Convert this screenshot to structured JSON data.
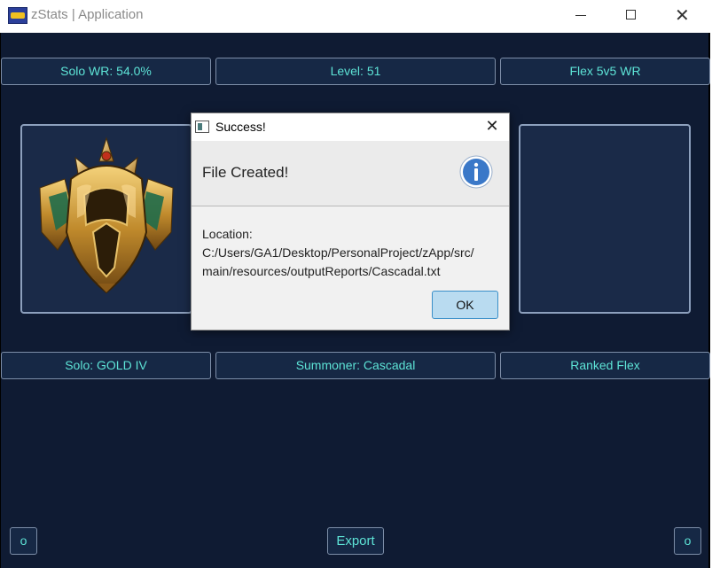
{
  "window": {
    "title": "zStats | Application",
    "icon": "zstats-logo-icon",
    "controls": [
      "minimize-icon",
      "maximize-icon",
      "close-icon"
    ]
  },
  "top_row": {
    "solo_wr": "Solo WR: 54.0%",
    "level": "Level: 51",
    "flex_wr": "Flex 5v5 WR"
  },
  "panels": {
    "left": {
      "emblem": "gold-rank-emblem-icon"
    },
    "right": {
      "emblem": ""
    }
  },
  "bottom_row": {
    "solo_rank": "Solo: GOLD IV",
    "summoner": "Summoner: Cascadal",
    "ranked_flex": "Ranked Flex"
  },
  "footer": {
    "left_button": "o",
    "export_button": "Export",
    "right_button": "o"
  },
  "dialog": {
    "title": "Success!",
    "header": "File Created!",
    "icon": "info-icon",
    "location_label": "Location:",
    "location_lines": [
      "C:/Users/GA1/Desktop/PersonalProject/zApp/src/",
      "main/resources/outputReports/Cascadal.txt"
    ],
    "ok_label": "OK"
  },
  "colors": {
    "background": "#0f1b33",
    "button_text": "#5de3d6",
    "panel": "#1a2a48",
    "ok_button": "#b9dbf0",
    "info_blue": "#3a78c8"
  }
}
